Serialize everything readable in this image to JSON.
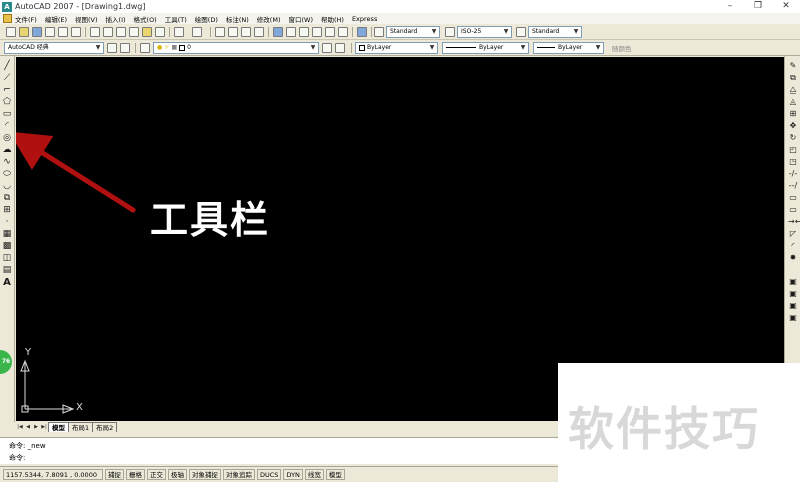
{
  "window": {
    "app_icon": "A",
    "title": "AutoCAD 2007 - [Drawing1.dwg]",
    "controls": [
      "–",
      "❐",
      "✕"
    ]
  },
  "menu": {
    "items": [
      "文件(F)",
      "编辑(E)",
      "视图(V)",
      "插入(I)",
      "格式(O)",
      "工具(T)",
      "绘图(D)",
      "标注(N)",
      "修改(M)",
      "窗口(W)",
      "帮助(H)",
      "Express"
    ]
  },
  "toolbar1": {
    "text_style": "Standard",
    "dim_style": "ISO-25",
    "table_style": "Standard"
  },
  "toolbar2": {
    "workspace": "AutoCAD 经典",
    "layer": "0",
    "color": "ByLayer",
    "linetype": "ByLayer",
    "lineweight": "ByLayer",
    "plot_style": "随颜色"
  },
  "canvas": {
    "background": "#000000",
    "annotation_text": "工具栏",
    "arrow_color": "#b01010",
    "ucs_y": "Y",
    "ucs_x": "X"
  },
  "tabs": {
    "nav": [
      "|◀",
      "◀",
      "▶",
      "▶|"
    ],
    "items": [
      "模型",
      "布局1",
      "布局2"
    ]
  },
  "command": {
    "line1": "命令: _new",
    "line2": "命令:"
  },
  "status": {
    "coords": "1157.5344, 7.8091 , 0.0000",
    "buttons": [
      "捕捉",
      "栅格",
      "正交",
      "极轴",
      "对象捕捉",
      "对象追踪",
      "DUCS",
      "DYN",
      "线宽",
      "模型"
    ]
  },
  "badge": {
    "text": "76"
  },
  "watermark": {
    "text": "软件技巧"
  }
}
